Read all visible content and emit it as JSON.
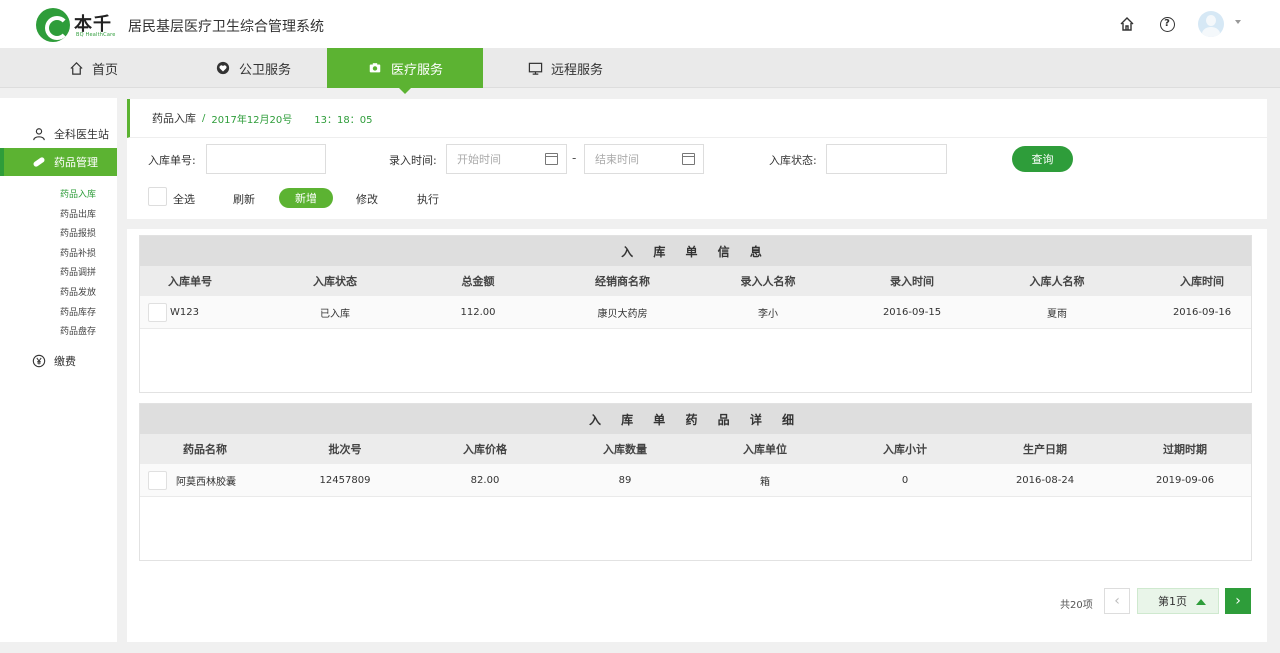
{
  "app": {
    "logo_text": "本千",
    "logo_sub": "BQ HealthCare",
    "system_title": "居民基层医疗卫生综合管理系统"
  },
  "header": {
    "icons": [
      "home-icon",
      "help-icon",
      "avatar",
      "chevron-down-icon"
    ]
  },
  "nav": {
    "items": [
      {
        "label": "首页",
        "icon": "home-icon"
      },
      {
        "label": "公卫服务",
        "icon": "heart-icon"
      },
      {
        "label": "医疗服务",
        "icon": "camera-icon",
        "active": true
      },
      {
        "label": "远程服务",
        "icon": "monitor-icon"
      }
    ]
  },
  "sidebar": {
    "groups": [
      {
        "label": "全科医生站",
        "icon": "doctor-icon"
      },
      {
        "label": "药品管理",
        "icon": "pill-icon",
        "active": true
      },
      {
        "label": "缴费",
        "icon": "yen-icon"
      }
    ],
    "sub_items": [
      "药品入库",
      "药品出库",
      "药品报损",
      "药品补损",
      "药品调拼",
      "药品发放",
      "药品库存",
      "药品盘存"
    ],
    "active_sub": "药品入库"
  },
  "breadcrumb": {
    "page": "药品入库",
    "sep": "/",
    "date": "2017年12月20号",
    "time": "13：18：05"
  },
  "filters": {
    "order_no_label": "入库单号:",
    "order_no_value": "",
    "entry_time_label": "录入时间:",
    "start_placeholder": "开始时间",
    "end_placeholder": "结束时间",
    "dash": "-",
    "status_label": "入库状态:",
    "status_value": "",
    "query_button": "查询"
  },
  "toolbar": {
    "select_all": "全选",
    "refresh": "刷新",
    "add": "新增",
    "edit": "修改",
    "execute": "执行"
  },
  "table1": {
    "title": "入 库 单 信 息",
    "columns": [
      "入库单号",
      "入库状态",
      "总金额",
      "经销商名称",
      "录入人名称",
      "录入时间",
      "入库人名称",
      "入库时间"
    ],
    "rows": [
      [
        "W123",
        "已入库",
        "112.00",
        "康贝大药房",
        "李小",
        "2016-09-15",
        "夏雨",
        "2016-09-16"
      ]
    ]
  },
  "table2": {
    "title": "入 库 单 药 品 详 细",
    "columns": [
      "药品名称",
      "批次号",
      "入库价格",
      "入库数量",
      "入库单位",
      "入库小计",
      "生产日期",
      "过期时期"
    ],
    "rows": [
      [
        "阿莫西林胶囊",
        "12457809",
        "82.00",
        "89",
        "箱",
        "0",
        "2016-08-24",
        "2019-09-06"
      ]
    ]
  },
  "pagination": {
    "total": "共20项",
    "current": "第1页",
    "prev": "‹",
    "next": "›"
  },
  "colors": {
    "brand_green": "#2e9d3a",
    "active_green": "#5cb332"
  }
}
